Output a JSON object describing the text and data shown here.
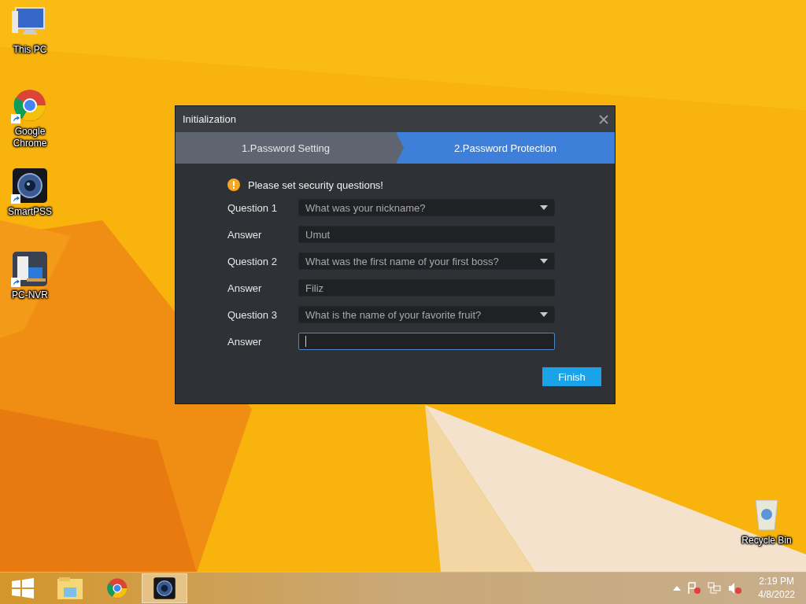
{
  "desktop_icons": [
    {
      "kind": "pc",
      "label": "This PC",
      "shortcut": false
    },
    {
      "kind": "chrome",
      "label": "Google Chrome",
      "shortcut": true
    },
    {
      "kind": "camera",
      "label": "SmartPSS",
      "shortcut": true
    },
    {
      "kind": "nvr",
      "label": "PC-NVR",
      "shortcut": true
    },
    {
      "kind": "bin",
      "label": "Recycle Bin",
      "shortcut": false
    }
  ],
  "dialog": {
    "title": "Initialization",
    "steps": [
      {
        "label": "1.Password Setting",
        "selected": false
      },
      {
        "label": "2.Password Protection",
        "selected": true
      }
    ],
    "notice": "Please set security questions!",
    "rows": [
      {
        "kind": "select",
        "label": "Question 1",
        "value": "What was your nickname?"
      },
      {
        "kind": "input",
        "label": "Answer",
        "value": "Umut",
        "focused": false
      },
      {
        "kind": "select",
        "label": "Question 2",
        "value": "What was the first name of your first boss?"
      },
      {
        "kind": "input",
        "label": "Answer",
        "value": "Filiz",
        "focused": false
      },
      {
        "kind": "select",
        "label": "Question 3",
        "value": "What is the name of your favorite fruit?"
      },
      {
        "kind": "input",
        "label": "Answer",
        "value": "",
        "focused": true
      }
    ],
    "finish_button": "Finish"
  },
  "taskbar": {
    "apps": [
      {
        "kind": "explorer",
        "selected": false
      },
      {
        "kind": "chrome",
        "selected": false
      },
      {
        "kind": "camera",
        "selected": true
      }
    ],
    "clock_time": "2:19 PM",
    "clock_date": "4/8/2022"
  }
}
